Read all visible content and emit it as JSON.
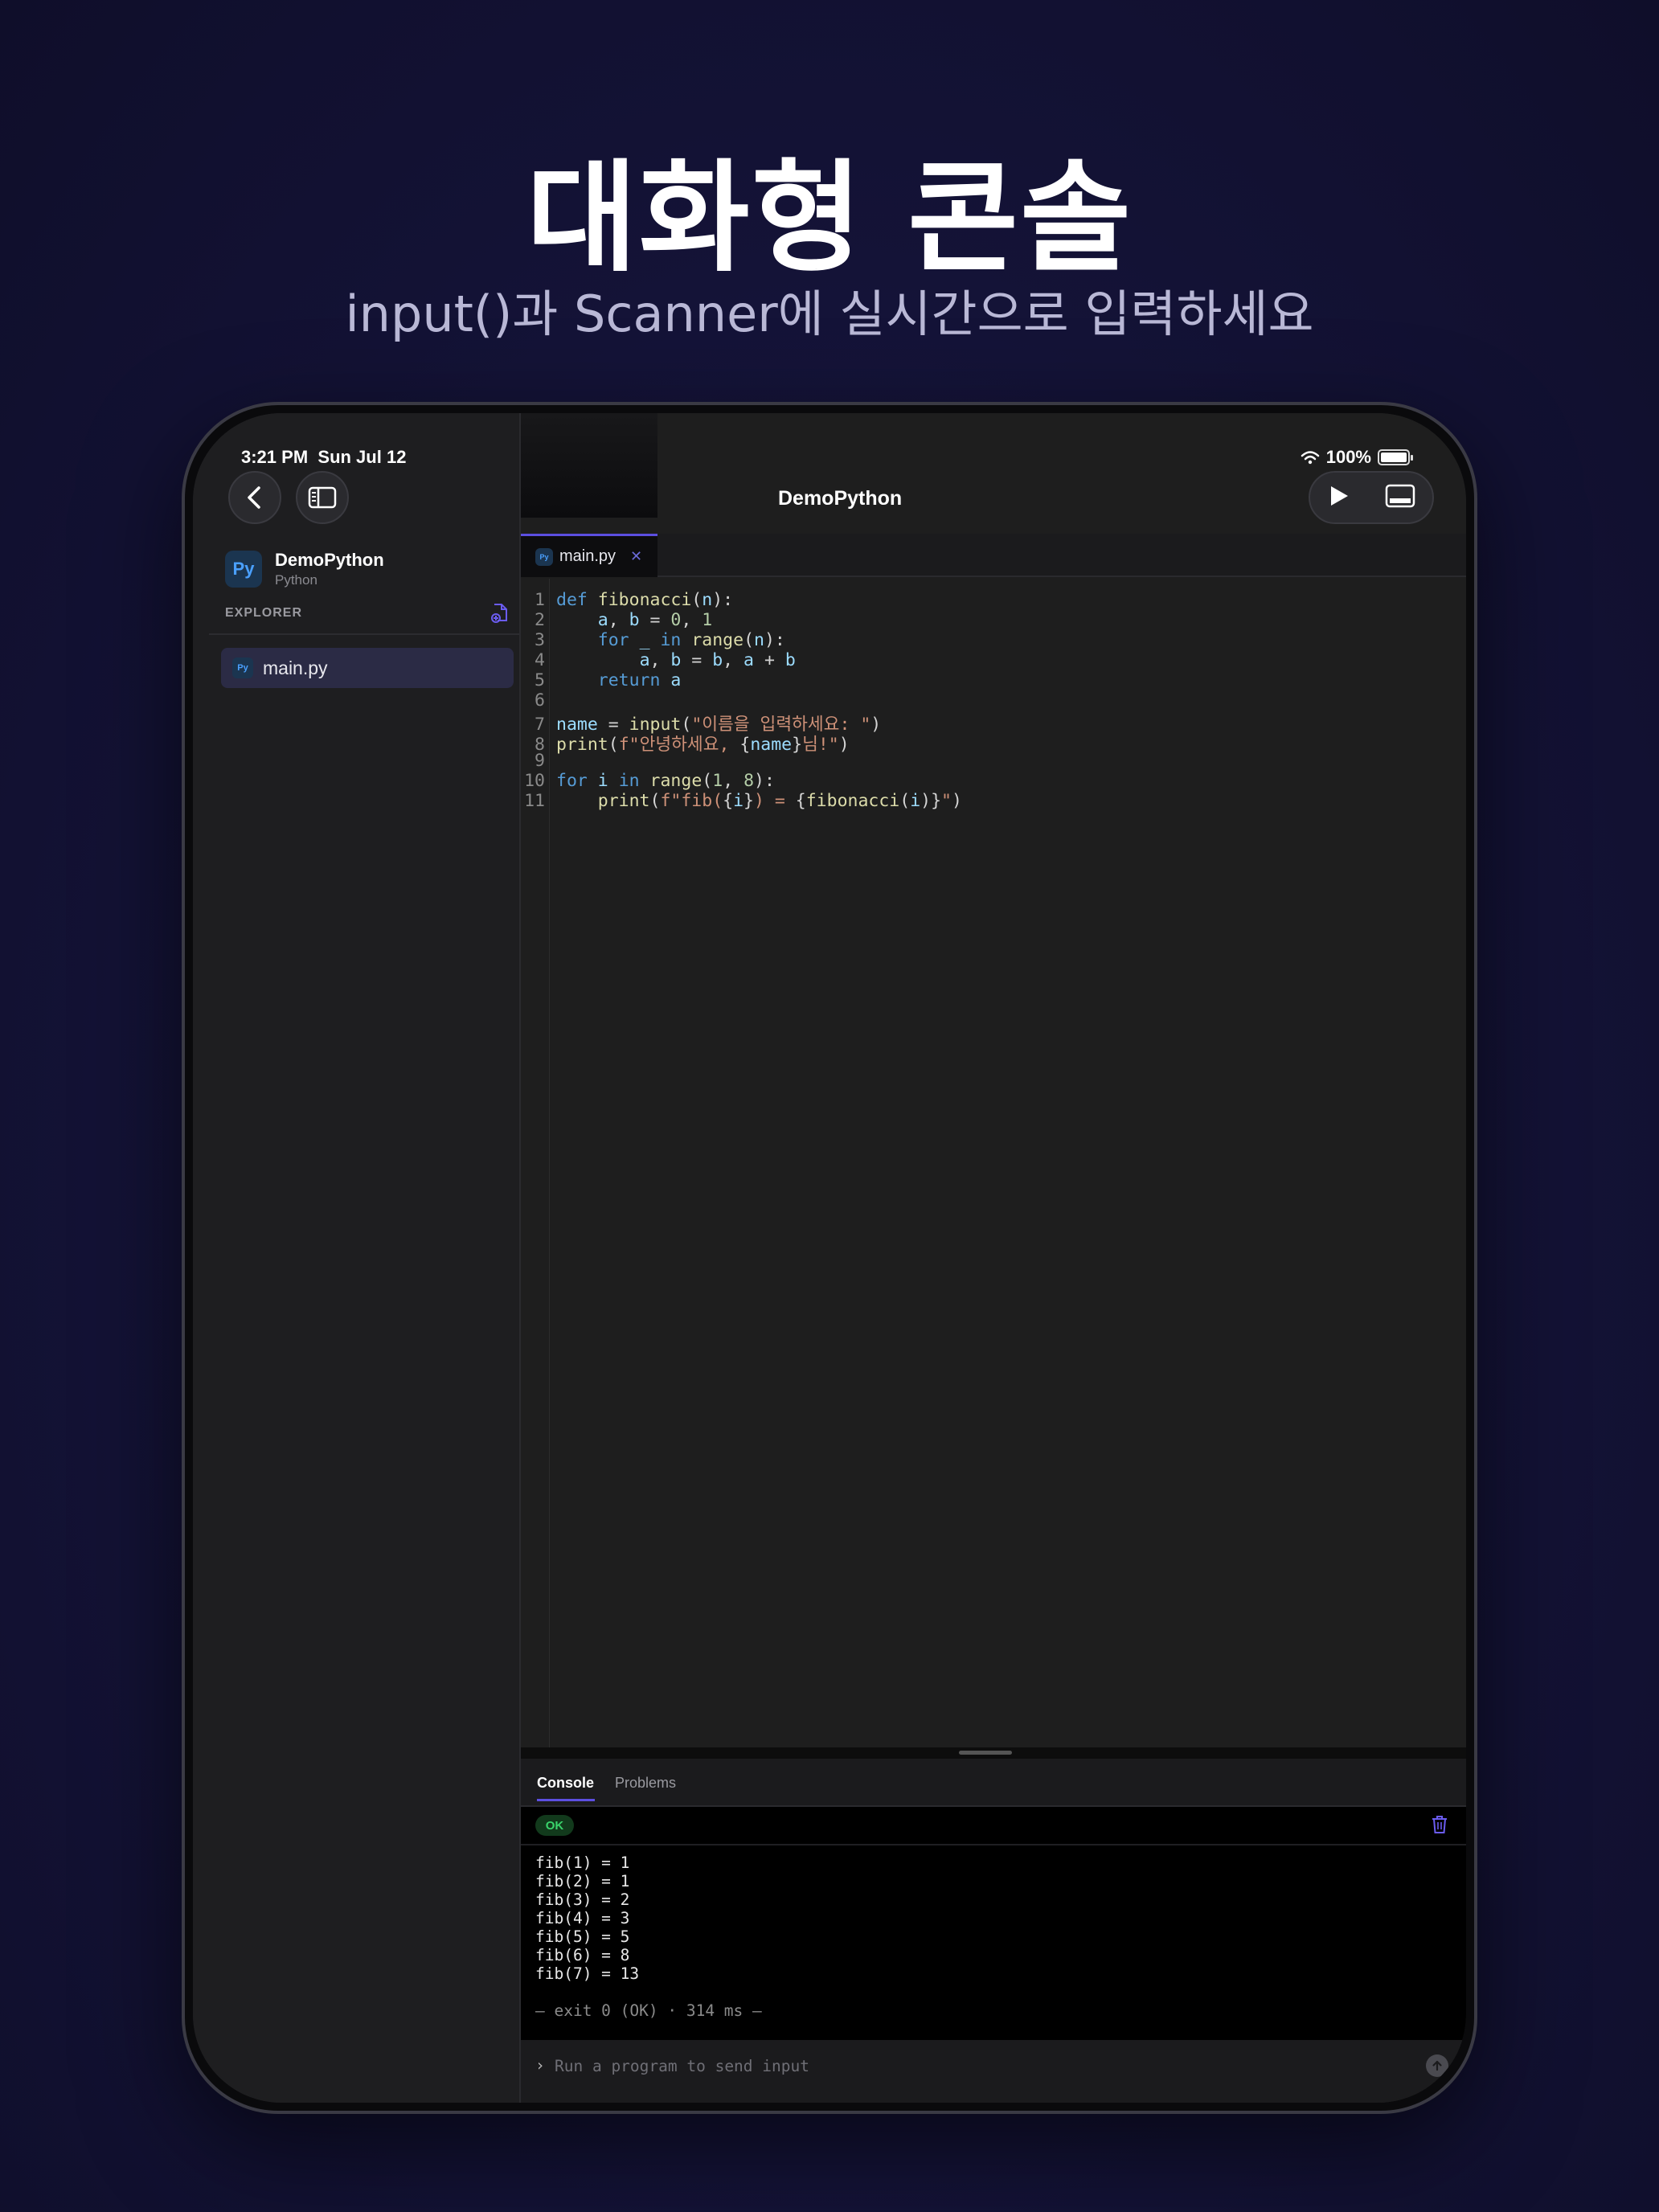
{
  "hero": {
    "title": "대화형 콘솔",
    "subtitle": "input()과 Scanner에 실시간으로 입력하세요"
  },
  "status_bar": {
    "time": "3:21 PM",
    "date": "Sun Jul 12",
    "battery": "100%"
  },
  "sidebar": {
    "project_name": "DemoPython",
    "project_lang": "Python",
    "project_badge": "Py",
    "explorer_label": "EXPLORER",
    "files": [
      {
        "name": "main.py",
        "badge": "Py",
        "selected": true
      }
    ]
  },
  "header": {
    "title": "DemoPython"
  },
  "tabs": [
    {
      "label": "main.py",
      "badge": "Py",
      "active": true
    }
  ],
  "editor": {
    "line_numbers": [
      "1",
      "2",
      "3",
      "4",
      "5",
      "6",
      "7",
      "8",
      "9",
      "10",
      "11"
    ]
  },
  "panel": {
    "tabs": [
      "Console",
      "Problems"
    ],
    "status": "OK",
    "output": [
      "fib(1) = 1",
      "fib(2) = 1",
      "fib(3) = 2",
      "fib(4) = 3",
      "fib(5) = 5",
      "fib(6) = 8",
      "fib(7) = 13"
    ],
    "exit_line": "— exit 0 (OK) · 314 ms —",
    "input_prompt": "›",
    "input_placeholder": "Run a program to send input"
  },
  "colors": {
    "accent": "#5c4fe0",
    "ok": "#3ad36b",
    "keyword": "#569cd6",
    "function": "#dcdcaa",
    "identifier": "#9cdcfe",
    "number": "#b5cea8",
    "string": "#ce9178"
  },
  "icons": [
    "back-icon",
    "sidebar-toggle-icon",
    "new-file-icon",
    "wifi-icon",
    "battery-icon",
    "play-icon",
    "panel-toggle-icon",
    "close-icon",
    "trash-icon",
    "send-icon"
  ]
}
